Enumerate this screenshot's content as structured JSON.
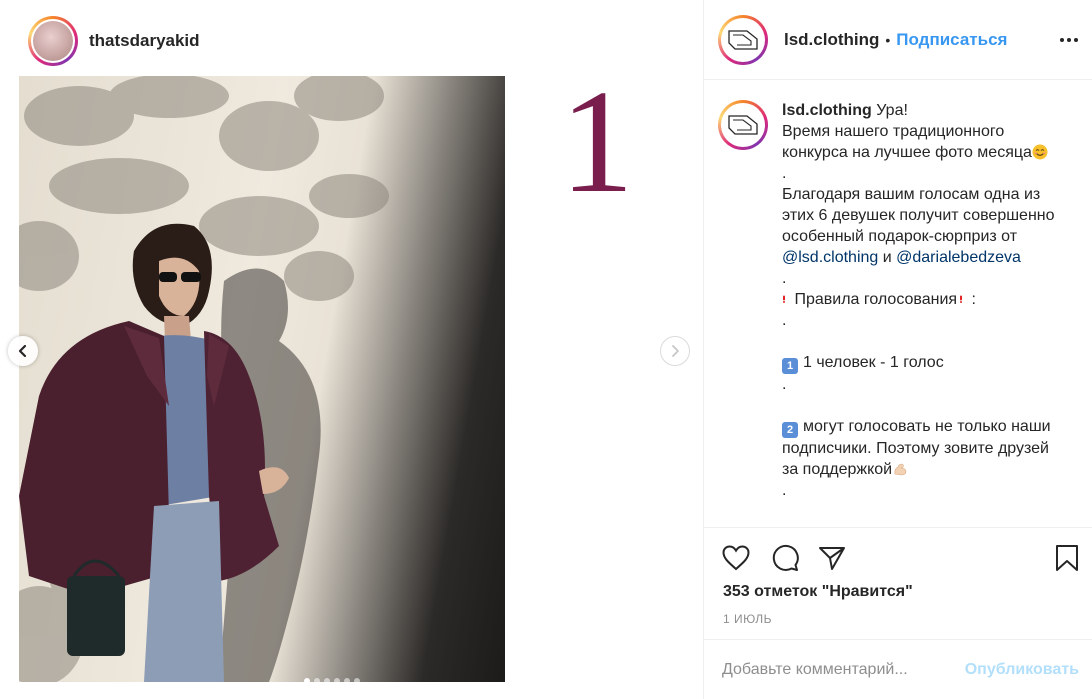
{
  "post": {
    "inner_account": "thatsdaryakid",
    "overlay_number": "1",
    "carousel": {
      "count": 6,
      "active_index": 0
    }
  },
  "header": {
    "username": "lsd.clothing",
    "separator": "•",
    "follow_label": "Подписаться",
    "logo_text": "LSD"
  },
  "caption": {
    "username": "lsd.clothing",
    "first": "Ура!",
    "l1": "Время нашего традиционного",
    "l2": "конкурса на лучшее фото месяца",
    "dot": ".",
    "l3": "Благодаря вашим голосам одна из",
    "l4": "этих 6 девушек получит совершенно",
    "l5": "особенный подарок-сюрприз от",
    "mention1": "@lsd.clothing",
    "and": "и",
    "mention2": "@darialebedzeva",
    "rules": "Правила голосования",
    "rules_tail": ":",
    "key1": "1",
    "rule1": "1 человек - 1 голос",
    "key2": "2",
    "rule2a": "могут голосовать не только наши",
    "rule2b": "подписчики. Поэтому зовите друзей",
    "rule2c": "за поддержкой"
  },
  "actions": {
    "likes": "353 отметок \"Нравится\"",
    "date": "1 ИЮЛЬ"
  },
  "comment": {
    "placeholder": "Добавьте комментарий...",
    "post_label": "Опубликовать"
  },
  "icons": [
    "heart-icon",
    "comment-icon",
    "share-icon",
    "bookmark-icon",
    "more-icon",
    "chevron-left-icon",
    "chevron-right-icon"
  ],
  "colors": {
    "link": "#3897f0",
    "mention": "#003569",
    "overlay_number": "#7a1f4d",
    "muted": "#8e8e8e"
  }
}
